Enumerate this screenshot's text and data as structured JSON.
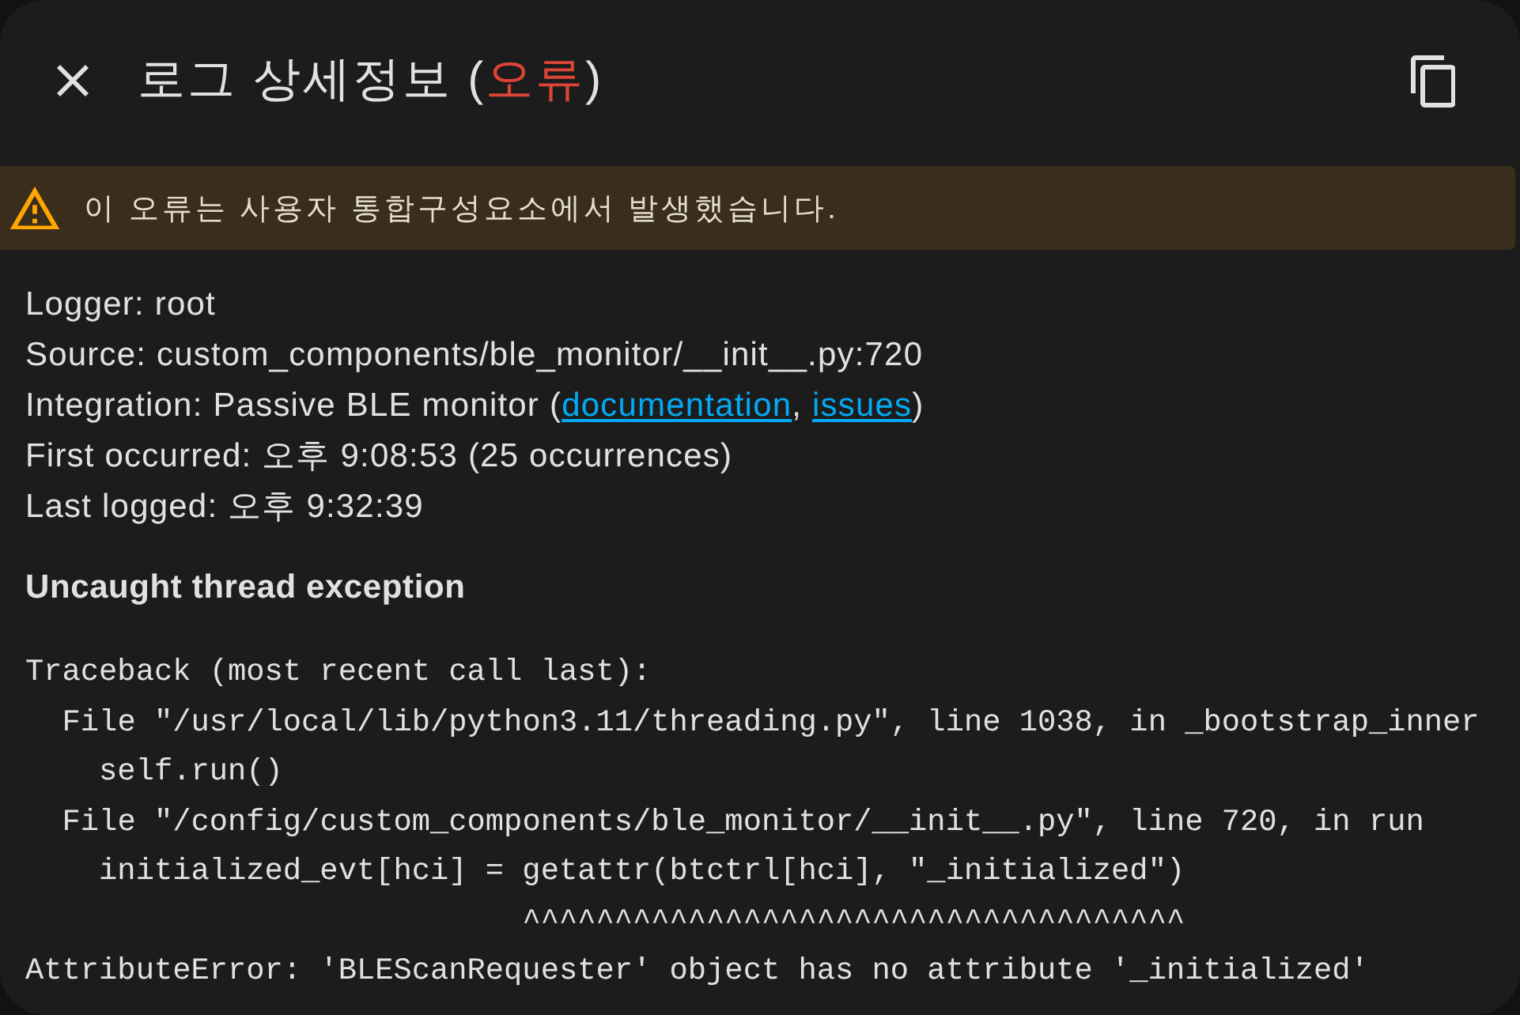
{
  "header": {
    "title": [
      {
        "kind": "plain",
        "text": "로그 상세정보 ("
      },
      {
        "kind": "error",
        "text": "오류"
      },
      {
        "kind": "plain",
        "text": ")"
      }
    ]
  },
  "warning": {
    "text": "이 오류는 사용자 통합구성요소에서 발생했습니다."
  },
  "details": [
    {
      "kind": "plain",
      "text": "Logger: root"
    },
    {
      "kind": "plain",
      "text": "Source: custom_components/ble_monitor/__init__.py:720"
    },
    {
      "kind": "links",
      "text": "Integration: Passive BLE monitor (",
      "links": [
        {
          "text": "documentation",
          "after": ", "
        },
        {
          "text": "issues",
          "after": ")"
        }
      ]
    },
    {
      "kind": "plain",
      "text": "First occurred: 오후 9:08:53 (25 occurrences)"
    },
    {
      "kind": "plain",
      "text": "Last logged: 오후 9:32:39"
    }
  ],
  "message": "Uncaught thread exception",
  "traceback": [
    "Traceback (most recent call last):",
    "  File \"/usr/local/lib/python3.11/threading.py\", line 1038, in _bootstrap_inner",
    "    self.run()",
    "  File \"/config/custom_components/ble_monitor/__init__.py\", line 720, in run",
    "    initialized_evt[hci] = getattr(btctrl[hci], \"_initialized\")",
    "                           ^^^^^^^^^^^^^^^^^^^^^^^^^^^^^^^^^^^^",
    "AttributeError: 'BLEScanRequester' object has no attribute '_initialized'"
  ]
}
